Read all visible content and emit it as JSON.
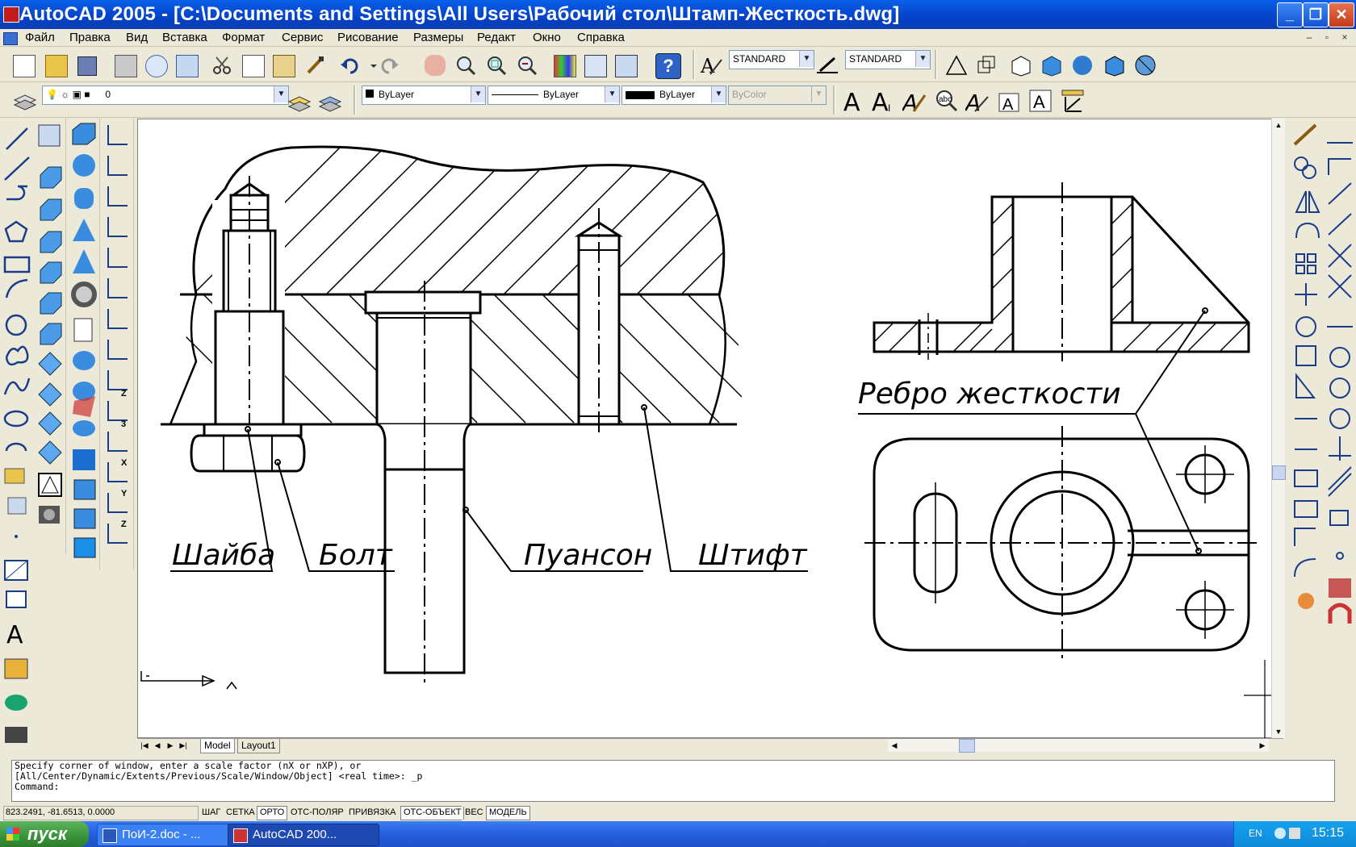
{
  "window": {
    "title": "AutoCAD 2005 - [C:\\Documents and Settings\\All Users\\Рабочий стол\\Штамп-Жесткость.dwg]",
    "controls": {
      "minimize": "_",
      "maximize": "❐",
      "close": "✕"
    }
  },
  "menu": {
    "items": [
      "Файл",
      "Правка",
      "Вид",
      "Вставка",
      "Формат",
      "Сервис",
      "Рисование",
      "Размеры",
      "Редакт",
      "Окно",
      "Справка"
    ],
    "mdi_controls": {
      "minimize": "–",
      "restore": "▫",
      "close": "×"
    }
  },
  "toolbar": {
    "text_style": "STANDARD",
    "dim_style": "STANDARD",
    "layer": "0",
    "color": "ByLayer",
    "linetype": "ByLayer",
    "lineweight": "ByLayer",
    "plot_style": "ByColor"
  },
  "drawing": {
    "labels": {
      "washer": "Шайба",
      "bolt": "Болт",
      "punch": "Пуансон",
      "pin": "Штифт",
      "rib": "Ребро жесткости"
    }
  },
  "tabs": {
    "model": "Model",
    "layout1": "Layout1"
  },
  "command": {
    "line1": "Specify corner of window, enter a scale factor (nX or nXP), or",
    "line2": "[All/Center/Dynamic/Extents/Previous/Scale/Window/Object] <real time>: _p",
    "prompt": "Command:"
  },
  "status": {
    "coordinates": "823.2491, -81.6513, 0.0000",
    "buttons": [
      "ШАГ",
      "СЕТКА",
      "ОРТО",
      "ОТС-ПОЛЯР",
      "ПРИВЯЗКА",
      "ОТС-ОБЪЕКТ",
      "ВЕС",
      "МОДЕЛЬ"
    ],
    "active": [
      "ОРТО",
      "ОТС-ОБЪЕКТ",
      "МОДЕЛЬ"
    ]
  },
  "taskbar": {
    "start": "пуск",
    "tasks": [
      "ПоИ-2.doc - ...",
      "AutoCAD 200..."
    ],
    "lang": "EN",
    "clock": "15:15"
  }
}
